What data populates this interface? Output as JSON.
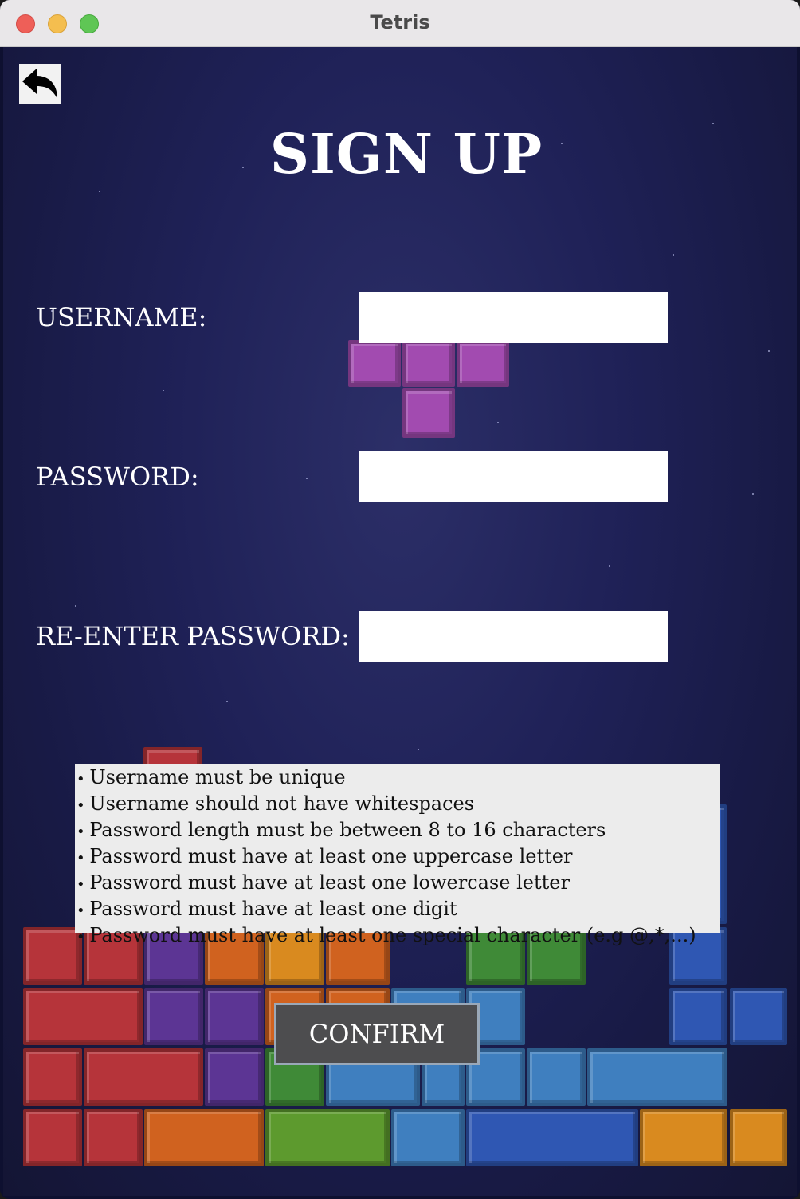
{
  "window": {
    "title": "Tetris"
  },
  "page": {
    "heading": "SIGN UP"
  },
  "form": {
    "username_label": "USERNAME:",
    "username_value": "",
    "password_label": "PASSWORD:",
    "password_value": "",
    "reenter_label": "RE-ENTER PASSWORD:",
    "reenter_value": ""
  },
  "rules": [
    "Username must be unique",
    "Username should not have whitespaces",
    "Password length must be between 8 to 16 characters",
    "Password must have at least one uppercase letter",
    "Password must have at least one lowercase letter",
    "Password must have at least one digit",
    "Password must have at least one special character (e.g @,*,...)"
  ],
  "confirm_label": "CONFIRM",
  "icons": {
    "back": "back-arrow-icon"
  },
  "colors": {
    "background": "#1f2157",
    "field": "#ffffff",
    "rules_box": "#ececec",
    "confirm_bg": "#4d4d4f"
  }
}
